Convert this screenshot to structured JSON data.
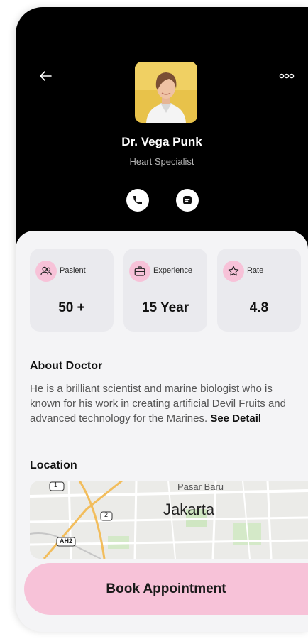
{
  "doctor": {
    "name": "Dr. Vega Punk",
    "specialty": "Heart Specialist"
  },
  "header": {
    "back_icon": "arrow-left-icon",
    "more_icon": "more-dots-icon",
    "call_icon": "phone-icon",
    "chat_icon": "chat-icon"
  },
  "stats": [
    {
      "label": "Pasient",
      "value": "50 +",
      "icon": "users-icon"
    },
    {
      "label": "Experience",
      "value": "15 Year",
      "icon": "briefcase-icon"
    },
    {
      "label": "Rate",
      "value": "4.8",
      "icon": "star-icon"
    }
  ],
  "about": {
    "title": "About Doctor",
    "text": "He is a brilliant scientist and marine biologist who is known for his work in creating artificial Devil Fruits and advanced technology for the Marines.",
    "see_detail": "See Detail"
  },
  "location": {
    "title": "Location",
    "city": "Jakarta",
    "area": "Pasar Baru",
    "road_markers": [
      "1",
      "2",
      "AH2"
    ]
  },
  "book_button": "Book Appointment",
  "colors": {
    "accent_pink": "#f7c2d8",
    "header_bg": "#000000",
    "card_bg": "#eaeaee",
    "page_bg": "#f4f4f6"
  }
}
